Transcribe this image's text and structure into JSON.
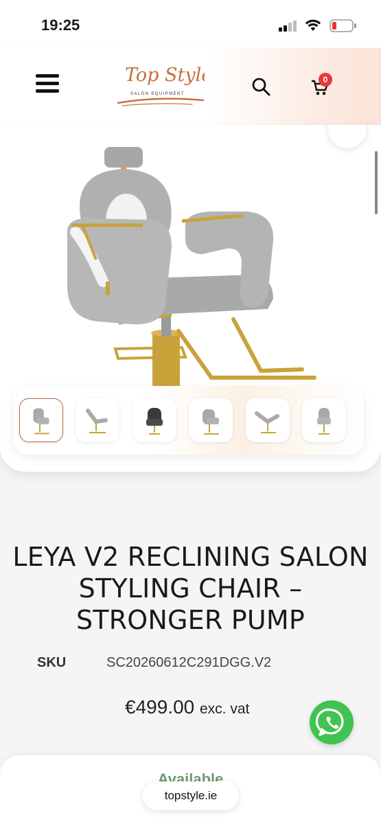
{
  "status_bar": {
    "time": "19:25"
  },
  "header": {
    "logo_text": "Top Style",
    "logo_subtext": "SALON EQUIPMENT",
    "cart_count": "0",
    "icons": {
      "menu": "hamburger-icon",
      "search": "search-icon",
      "cart": "cart-icon"
    }
  },
  "gallery": {
    "thumbnail_count": 6,
    "active_thumbnail": 1
  },
  "product": {
    "title": "LEYA V2 RECLINING SALON STYLING CHAIR – STRONGER PUMP",
    "sku_label": "SKU",
    "sku_value": "SC20260612C291DGG.V2",
    "price": "€499.00",
    "price_suffix": "exc. vat"
  },
  "availability": {
    "label": "Available"
  },
  "browser": {
    "url": "topstyle.ie"
  },
  "colors": {
    "accent": "#b46a4a",
    "badge": "#e53935",
    "whatsapp": "#40c351",
    "gold": "#c9a23a",
    "chair_grey": "#a9a9a9"
  }
}
